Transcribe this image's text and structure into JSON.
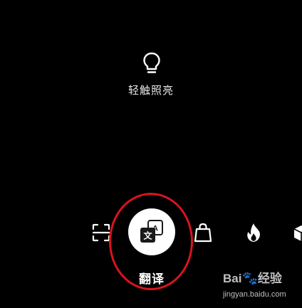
{
  "torch": {
    "icon": "lightbulb-icon",
    "label": "轻触照亮"
  },
  "modes": {
    "scan": {
      "icon": "scan-icon"
    },
    "translate": {
      "icon": "translate-icon",
      "label": "翻译",
      "selected": true,
      "badge_chars": [
        "文",
        "A"
      ]
    },
    "shop": {
      "icon": "shopping-bag-icon"
    },
    "hot": {
      "icon": "flame-icon"
    },
    "cube": {
      "icon": "cube-icon"
    }
  },
  "annotation": {
    "color": "#d9141d"
  },
  "watermark": {
    "brand_prefix": "Bai",
    "brand_paw": "🐾",
    "brand_suffix": "经验",
    "url": "jingyan.baidu.com"
  }
}
